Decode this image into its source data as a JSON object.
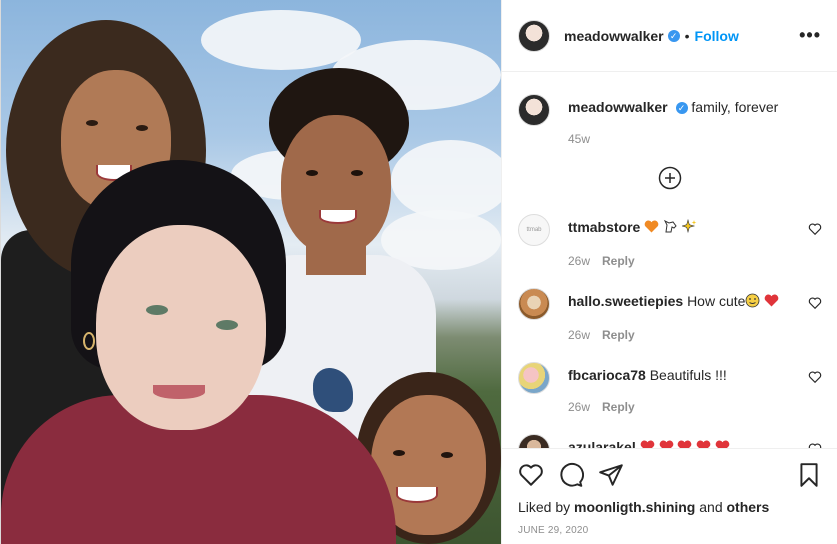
{
  "post": {
    "username": "meadowwalker",
    "follow_label": "Follow",
    "dot": "•",
    "more_glyph": "•••",
    "verified_glyph": "✓"
  },
  "caption": {
    "username": "meadowwalker",
    "text": "family, forever",
    "time": "45w"
  },
  "comments": [
    {
      "username": "ttmabstore",
      "text": "",
      "time": "26w",
      "reply": "Reply",
      "avatar_text": "ttmab"
    },
    {
      "username": "hallo.sweetiepies",
      "text": "How cute",
      "time": "26w",
      "reply": "Reply"
    },
    {
      "username": "fbcarioca78",
      "text": "Beautifuls !!!",
      "time": "26w",
      "reply": "Reply"
    },
    {
      "username": "azularakel",
      "text": "",
      "time": "",
      "reply": ""
    }
  ],
  "likes": {
    "prefix": "Liked by",
    "user": "moonligth.shining",
    "and": "and",
    "others": "others"
  },
  "date": "JUNE 29, 2020",
  "icons": [
    "heart-icon",
    "comment-icon",
    "share-icon",
    "bookmark-icon",
    "plus-circle-icon",
    "more-icon"
  ],
  "colors": {
    "accent": "#0095f6",
    "verified": "#3897f0",
    "heart_emoji": "#e0343a",
    "sweater": "#8a2c3e"
  }
}
